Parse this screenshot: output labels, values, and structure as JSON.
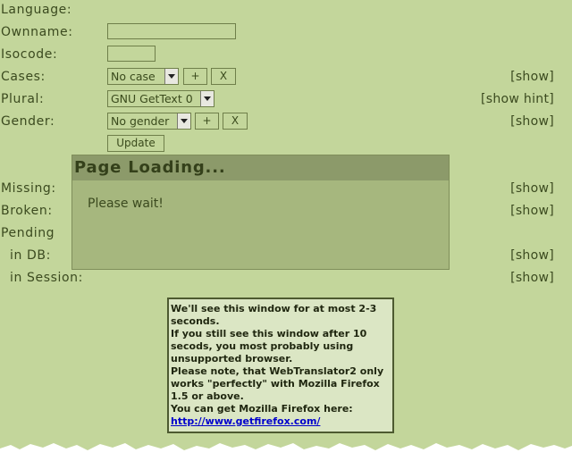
{
  "labels": {
    "language": "Language:",
    "ownname": "Ownname:",
    "isocode": "Isocode:",
    "cases": "Cases:",
    "plural": "Plural:",
    "gender": "Gender:",
    "missing": "Missing:",
    "broken": "Broken:",
    "pending": "Pending",
    "in_db": "in DB:",
    "in_session": "in Session:"
  },
  "controls": {
    "cases_select": "No case",
    "plural_select": "GNU GetText 0",
    "gender_select": "No gender",
    "add": "+",
    "remove": "X",
    "update": "Update"
  },
  "links": {
    "show": "[show]",
    "show_hint": "[show hint]"
  },
  "overlay": {
    "title": "Page Loading...",
    "message": "Please wait!"
  },
  "notice": {
    "line1": "We'll see this window for at most 2-3 seconds.",
    "line2": "If you still see this window after 10 secods, you most probably using unsupported browser.",
    "line3": "Please note, that WebTranslator2 only works \"perfectly\" with Mozilla Firefox 1.5 or above.",
    "line4": "You can get Mozilla Firefox here:",
    "url": "http://www.getfirefox.com/"
  }
}
